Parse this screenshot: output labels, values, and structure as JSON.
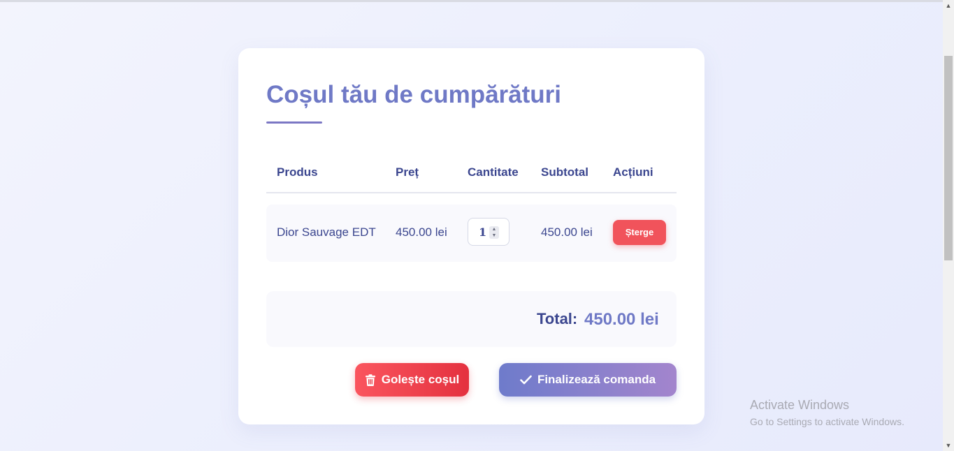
{
  "cart": {
    "title": "Coșul tău de cumpărături",
    "columns": [
      "Produs",
      "Preț",
      "Cantitate",
      "Subtotal",
      "Acțiuni"
    ],
    "items": [
      {
        "product": "Dior Sauvage EDT",
        "price": "450.00 lei",
        "quantity": "1",
        "subtotal": "450.00 lei",
        "delete_label": "Șterge"
      }
    ],
    "total_label": "Total:",
    "total_value": "450.00 lei",
    "clear_label": "Golește coșul",
    "checkout_label": "Finalizează comanda",
    "clear_icon": "trash-icon",
    "checkout_icon": "check-icon"
  },
  "watermark": {
    "line1": "Activate Windows",
    "line2": "Go to Settings to activate Windows."
  },
  "colors": {
    "accent": "#6f79c6",
    "text": "#3b468f",
    "danger": "#f1535b",
    "checkout_gradient_start": "#6e7bcb",
    "checkout_gradient_end": "#a385cd"
  }
}
